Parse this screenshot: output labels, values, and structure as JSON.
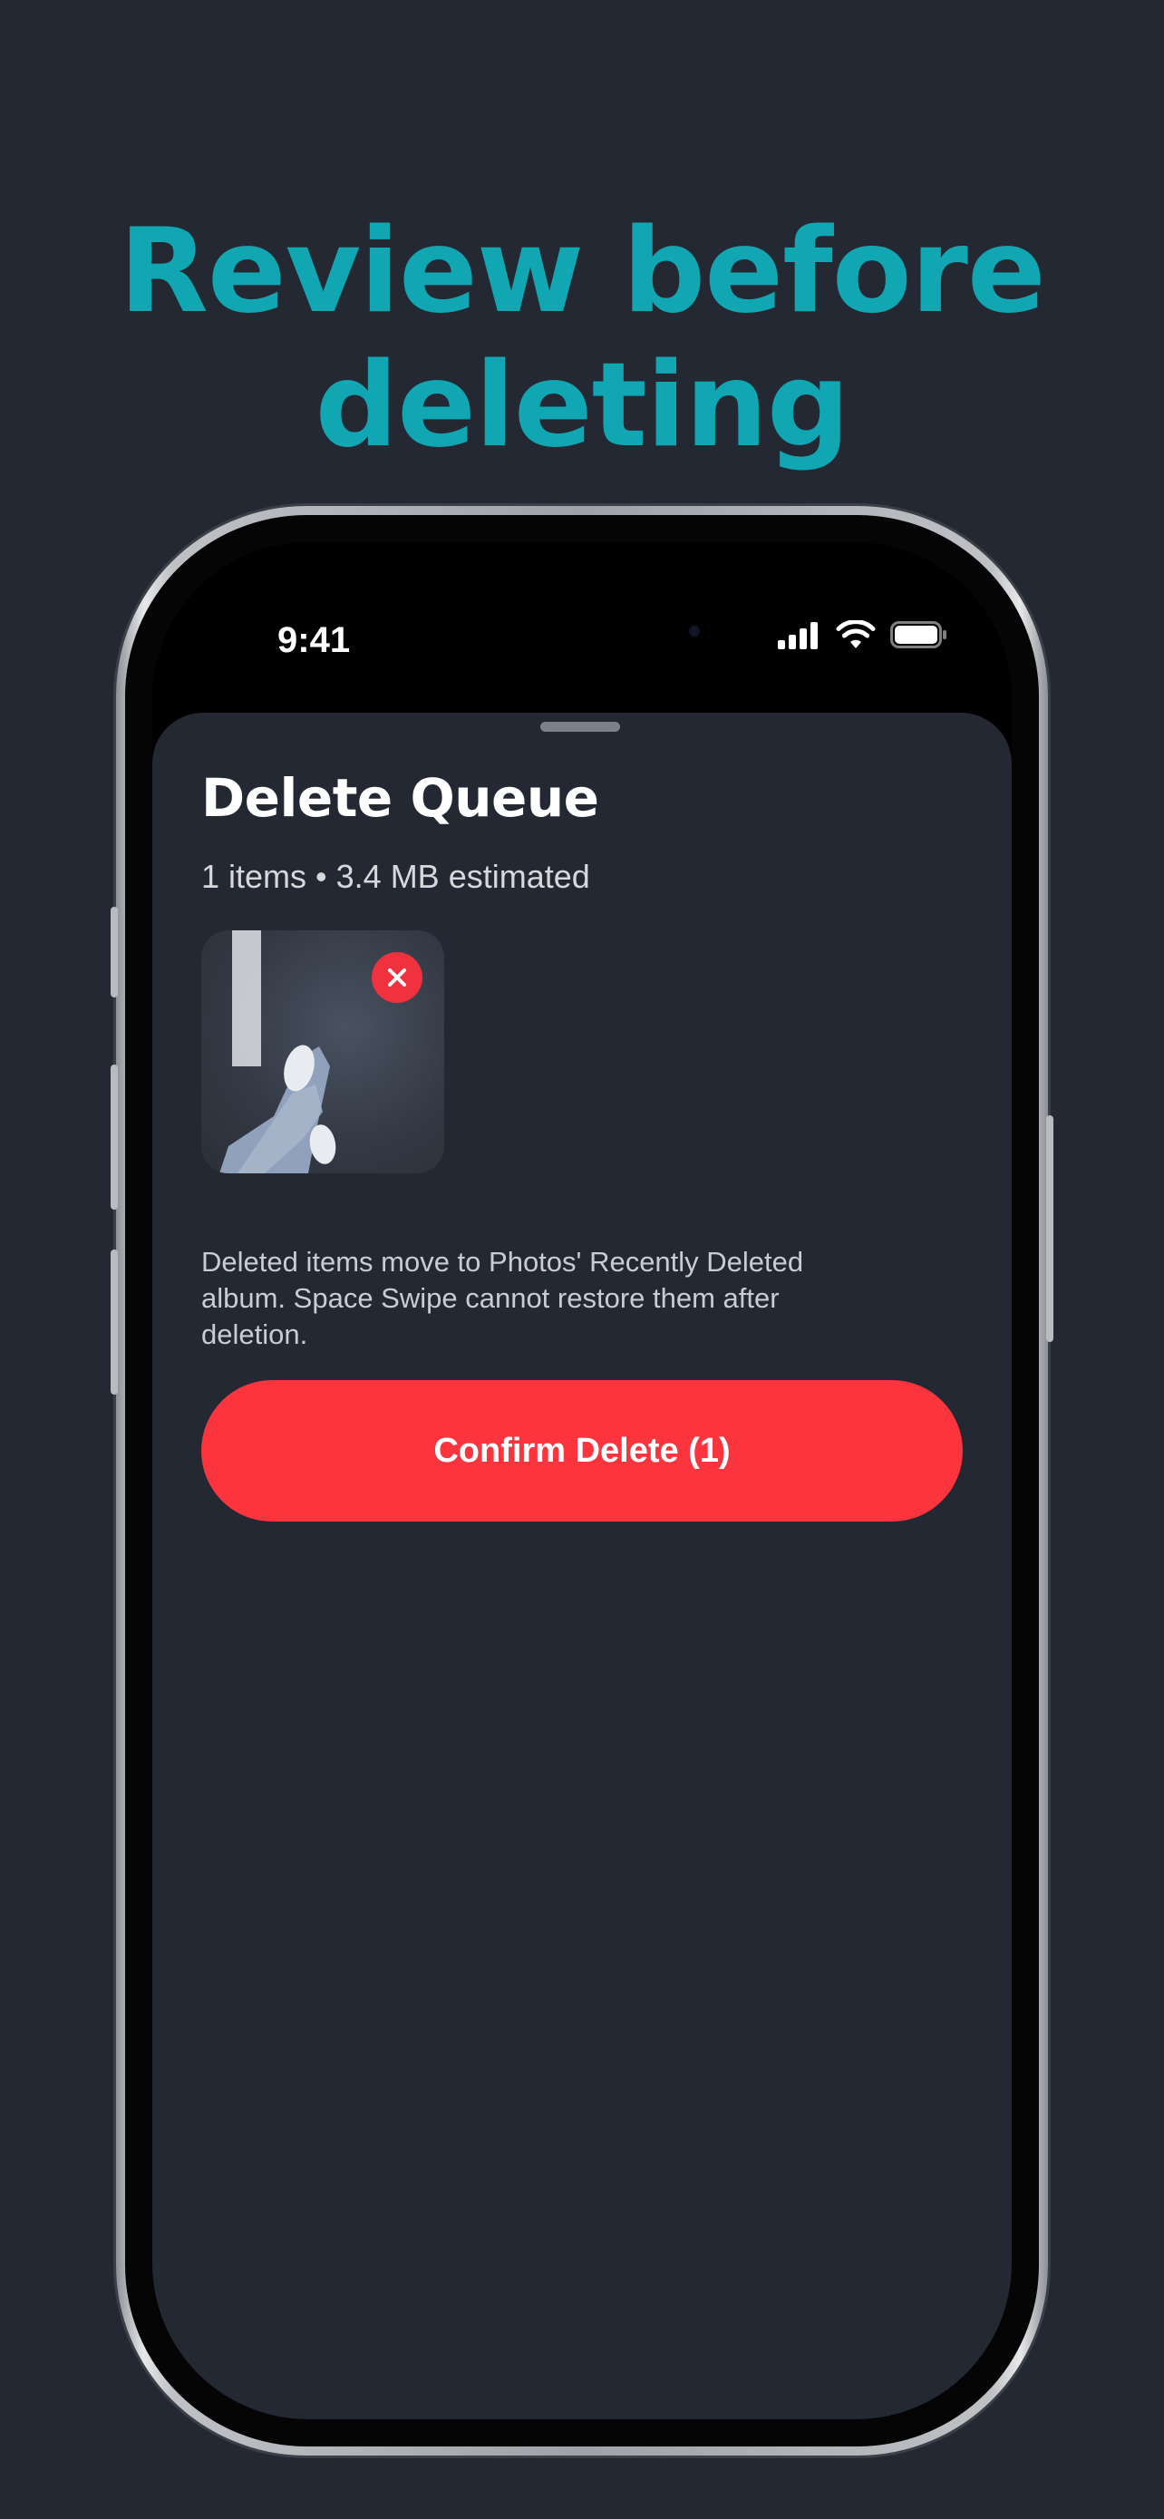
{
  "headline": {
    "line1": "Review before",
    "line2": "deleting"
  },
  "status_bar": {
    "time": "9:41",
    "icons": [
      "cellular-signal-icon",
      "wifi-icon",
      "battery-icon"
    ]
  },
  "sheet": {
    "title": "Delete Queue",
    "subtitle": "1 items • 3.4 MB estimated",
    "queue": [
      {
        "thumbnail": "photo-thumbnail",
        "remove_icon": "close-icon"
      }
    ],
    "note": "Deleted items move to Photos' Recently Deleted album. Space Swipe cannot restore them after deletion.",
    "confirm_label": "Confirm Delete (1)"
  },
  "colors": {
    "background": "#232833",
    "headline": "#10a7b3",
    "accent_red": "#fc343e",
    "remove_badge": "#f0323e"
  }
}
